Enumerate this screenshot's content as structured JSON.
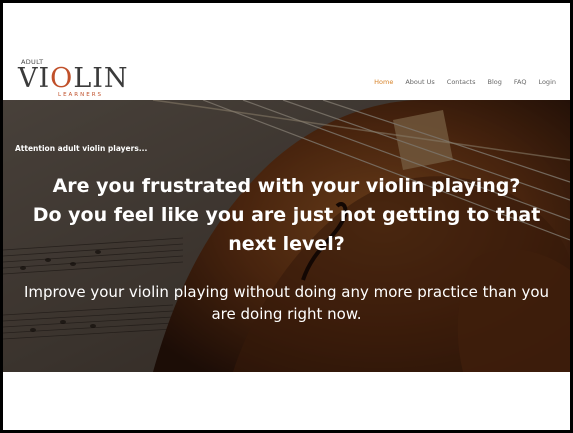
{
  "logo": {
    "top": "ADULT",
    "main_a": "VI",
    "main_o": "O",
    "main_b": "LIN",
    "sub": "LEARNERS"
  },
  "nav": {
    "items": [
      {
        "label": "Home",
        "active": true
      },
      {
        "label": "About Us",
        "active": false
      },
      {
        "label": "Contacts",
        "active": false
      },
      {
        "label": "Blog",
        "active": false
      },
      {
        "label": "FAQ",
        "active": false
      },
      {
        "label": "Login",
        "active": false
      }
    ]
  },
  "hero": {
    "eyebrow": "Attention adult violin players...",
    "headline_1": "Are you frustrated with your violin playing?",
    "headline_2": "Do you feel like you are just not getting to that",
    "headline_3": "next level?",
    "subline": "Improve your violin playing without doing any more practice than you are doing right now."
  },
  "colors": {
    "accent": "#d7832a",
    "logo_accent": "#c0502a",
    "nav_text": "#666666"
  }
}
